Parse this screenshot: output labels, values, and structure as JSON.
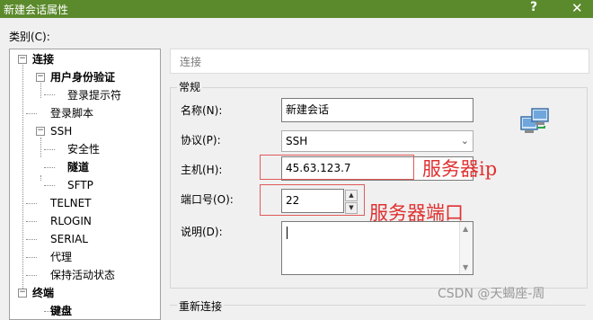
{
  "window": {
    "title": "新建会话属性",
    "help_symbol": "?",
    "close_symbol": "✕"
  },
  "category_label": "类别(C):",
  "tree": {
    "items": [
      {
        "label": "连接",
        "bold": true,
        "expander": "−"
      },
      {
        "label": "用户身份验证",
        "bold": true,
        "expander": "−"
      },
      {
        "label": "登录提示符"
      },
      {
        "label": "登录脚本"
      },
      {
        "label": "SSH",
        "expander": "−"
      },
      {
        "label": "安全性"
      },
      {
        "label": "隧道"
      },
      {
        "label": "SFTP"
      },
      {
        "label": "TELNET"
      },
      {
        "label": "RLOGIN"
      },
      {
        "label": "SERIAL"
      },
      {
        "label": "代理"
      },
      {
        "label": "保持活动状态"
      },
      {
        "label": "终端",
        "bold": true,
        "expander": "−"
      },
      {
        "label": "键盘"
      }
    ]
  },
  "header": {
    "title": "连接"
  },
  "general": {
    "title": "常规",
    "name_label": "名称(N):",
    "name_value": "新建会话",
    "protocol_label": "协议(P):",
    "protocol_value": "SSH",
    "host_label": "主机(H):",
    "host_value": "45.63.123.7",
    "port_label": "端口号(O):",
    "port_value": "22",
    "desc_label": "说明(D):",
    "desc_value": ""
  },
  "reconnect": {
    "title": "重新连接"
  },
  "annotations": {
    "host_note": "服务器ip",
    "port_note": "服务器端口",
    "color": "#e03030"
  },
  "watermark": "CSDN @天蝎座-周",
  "icons": {
    "session": "network-computers-icon",
    "dropdown": "chevron-down-icon"
  }
}
